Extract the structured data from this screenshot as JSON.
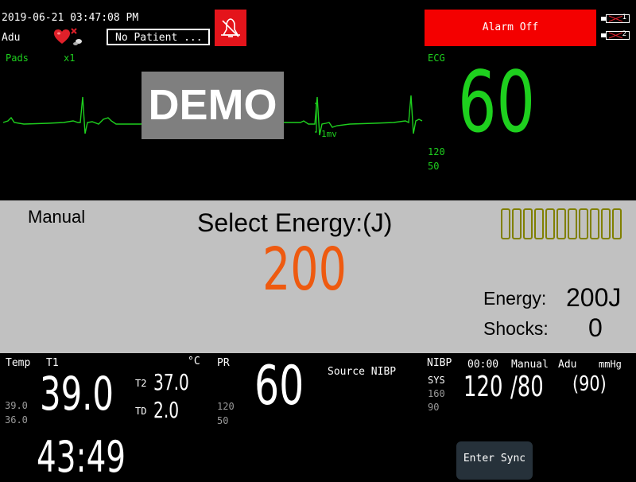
{
  "header": {
    "datetime": "2019-06-21 03:47:08 PM",
    "patient_type": "Adu",
    "patient_name": "No Patient ...",
    "alarm_status": "Alarm Off",
    "battery_1": "1",
    "battery_2": "2",
    "colors": {
      "alarm": "#f40000",
      "ecg": "#1ed01e"
    }
  },
  "ecg": {
    "lead": "Pads",
    "gain": "x1",
    "label": "ECG",
    "hr": "60",
    "hr_high": "120",
    "hr_low": "50",
    "watermark": "DEMO",
    "scale_label": "1mv"
  },
  "defib": {
    "mode": "Manual",
    "prompt": "Select Energy:(J)",
    "selected_energy": "200",
    "energy_label": "Energy:",
    "energy_value": "200J",
    "shocks_label": "Shocks:",
    "shocks_value": "0",
    "charge_segments": 11,
    "charge_level": 0
  },
  "temp": {
    "label": "Temp",
    "t1_label": "T1",
    "unit": "°C",
    "t1": "39.0",
    "high": "39.0",
    "low": "36.0",
    "t2_label": "T2",
    "t2": "37.0",
    "td_label": "TD",
    "td": "2.0"
  },
  "pr": {
    "label": "PR",
    "value": "60",
    "high": "120",
    "low": "50",
    "source": "Source NIBP"
  },
  "timer": "43:49",
  "nibp": {
    "label": "NIBP",
    "time": "00:00",
    "mode": "Manual",
    "patient": "Adu",
    "unit": "mmHg",
    "sys_label": "SYS",
    "sys_high": "160",
    "sys_low": "90",
    "sys": "120",
    "dia": "/80",
    "map": "(90)"
  },
  "buttons": {
    "sync": "Enter Sync"
  }
}
